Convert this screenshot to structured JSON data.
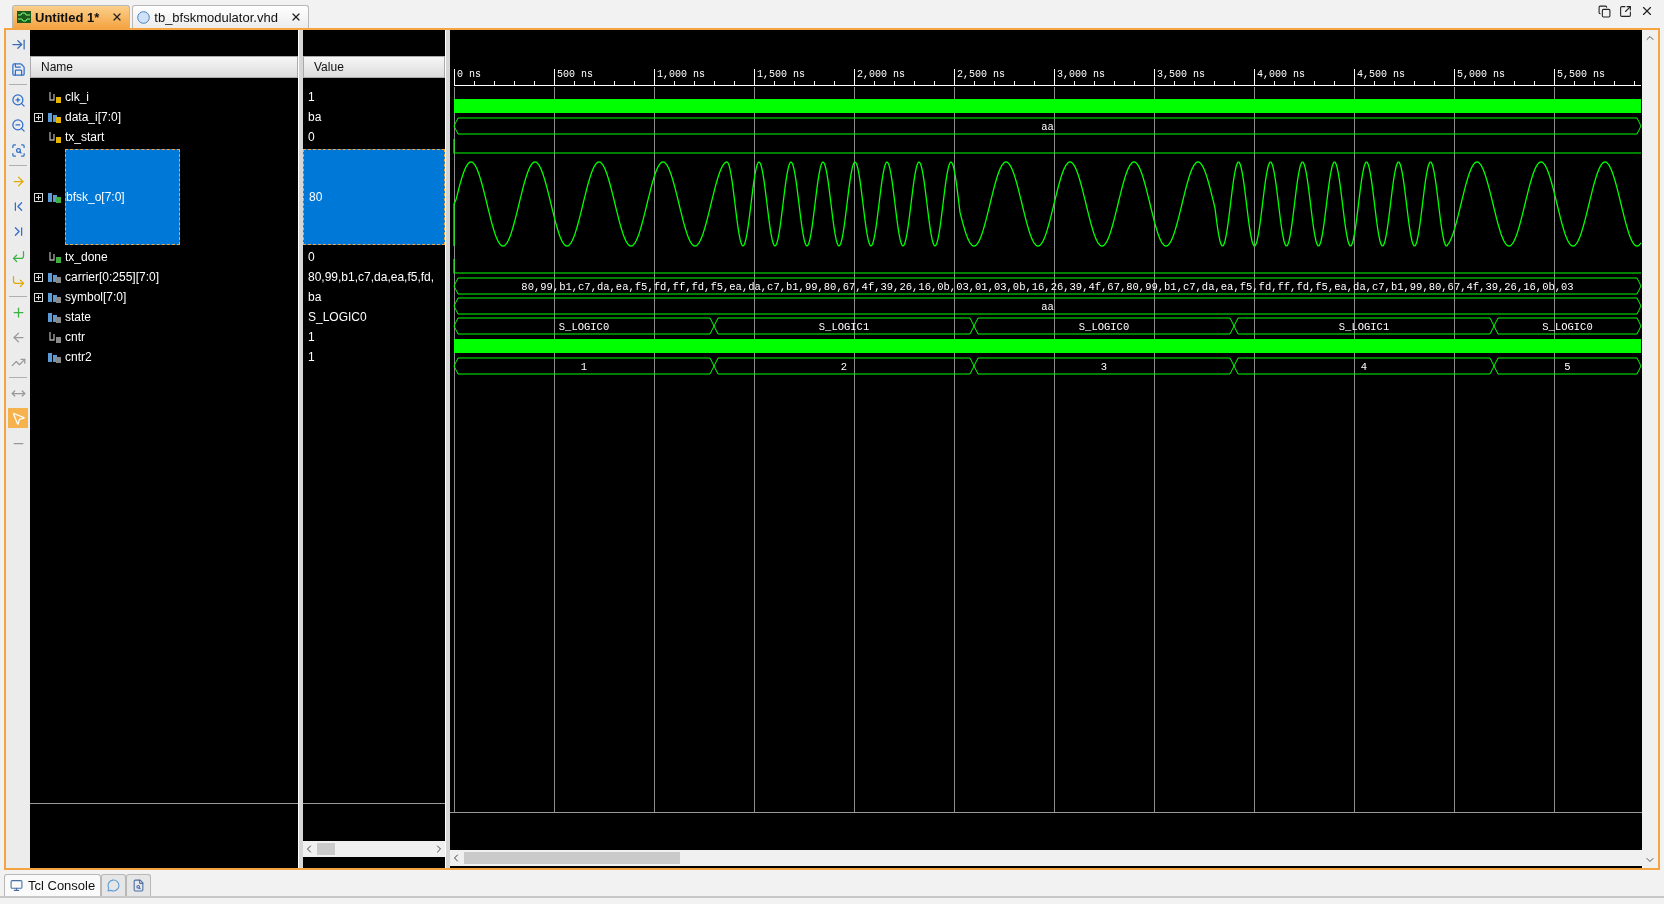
{
  "tabs": [
    {
      "label": "Untitled 1*",
      "selected": true,
      "kind": "waveform"
    },
    {
      "label": "tb_bfskmodulator.vhd",
      "selected": false,
      "kind": "vhdl"
    }
  ],
  "columns": {
    "name": "Name",
    "value": "Value"
  },
  "time_ruler": [
    "0 ns",
    "500 ns",
    "1,000 ns",
    "1,500 ns",
    "2,000 ns",
    "2,500 ns",
    "3,000 ns",
    "3,500 ns",
    "4,000 ns",
    "4,500 ns",
    "5,000 ns",
    "5,500 ns"
  ],
  "signals": [
    {
      "name": "clk_i",
      "value": "1",
      "kind": "clock",
      "color": "#e8b400",
      "expandable": false,
      "selected": false
    },
    {
      "name": "data_i[7:0]",
      "value": "ba",
      "kind": "bus",
      "color": "#e8b400",
      "expandable": true,
      "selected": false,
      "segments": [
        "aa"
      ]
    },
    {
      "name": "tx_start",
      "value": "0",
      "kind": "bit",
      "color": "#e8b400",
      "expandable": false,
      "selected": false
    },
    {
      "name": "bfsk_o[7:0]",
      "value": "80",
      "kind": "analog",
      "color": "#3cb043",
      "expandable": true,
      "selected": true
    },
    {
      "name": "tx_done",
      "value": "0",
      "kind": "bit",
      "color": "#3cb043",
      "expandable": false,
      "selected": false
    },
    {
      "name": "carrier[0:255][7:0]",
      "value": "80,99,b1,c7,da,ea,f5,fd,",
      "kind": "bus",
      "color": "#8a8a8a",
      "expandable": true,
      "selected": false,
      "segments": [
        "80,99,b1,c7,da,ea,f5,fd,ff,fd,f5,ea,da,c7,b1,99,80,67,4f,39,26,16,0b,03,01,03,0b,16,26,39,4f,67,80,99,b1,c7,da,ea,f5,fd,ff,fd,f5,ea,da,c7,b1,99,80,67,4f,39,26,16,0b,03"
      ]
    },
    {
      "name": "symbol[7:0]",
      "value": "ba",
      "kind": "bus",
      "color": "#8a8a8a",
      "expandable": true,
      "selected": false,
      "segments": [
        "aa"
      ]
    },
    {
      "name": "state",
      "value": "S_LOGIC0",
      "kind": "bus",
      "color": "#8a8a8a",
      "expandable": false,
      "selected": false,
      "segments": [
        "S_LOGIC0",
        "S_LOGIC1",
        "S_LOGIC0",
        "S_LOGIC1",
        "S_LOGIC0"
      ]
    },
    {
      "name": "cntr",
      "value": "1",
      "kind": "clock",
      "color": "#8a8a8a",
      "expandable": false,
      "selected": false
    },
    {
      "name": "cntr2",
      "value": "1",
      "kind": "bus",
      "color": "#8a8a8a",
      "expandable": false,
      "selected": false,
      "segments": [
        "1",
        "2",
        "3",
        "4",
        "5"
      ]
    }
  ],
  "bottom_tabs": [
    {
      "label": "Tcl Console",
      "kind": "console",
      "selected": true
    },
    {
      "kind": "messages",
      "selected": false
    },
    {
      "kind": "report",
      "selected": false
    }
  ]
}
